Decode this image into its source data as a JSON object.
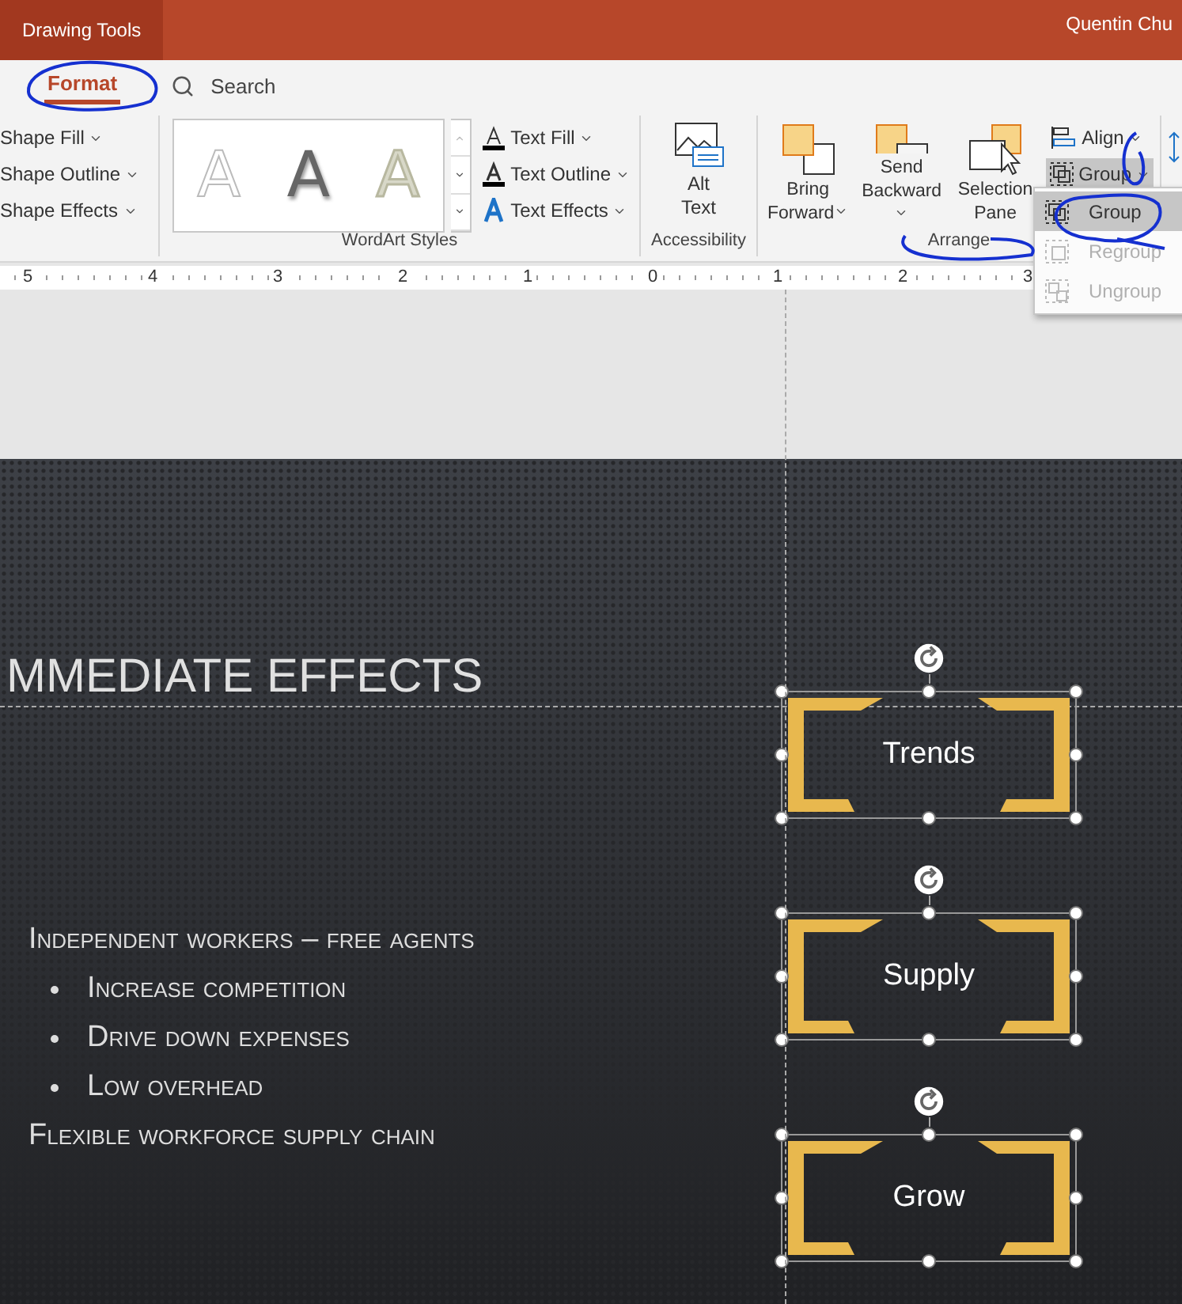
{
  "title_bar": {
    "context_tab": "Drawing Tools",
    "user": "Quentin Chu"
  },
  "tabs": [
    {
      "label": "Format",
      "selected": true
    }
  ],
  "search": {
    "placeholder": "Search"
  },
  "shape_styles": {
    "items": [
      "Shape Fill",
      "Shape Outline",
      "Shape Effects"
    ]
  },
  "wordart": {
    "label": "WordArt Styles",
    "gallery": [
      {
        "glyph": "A",
        "kind": "outline"
      },
      {
        "glyph": "A",
        "kind": "shadow"
      },
      {
        "glyph": "A",
        "kind": "gold"
      }
    ],
    "items": [
      {
        "label": "Text Fill",
        "kind": "fill"
      },
      {
        "label": "Text Outline",
        "kind": "outline"
      },
      {
        "label": "Text Effects",
        "kind": "effects"
      }
    ]
  },
  "accessibility": {
    "label": "Accessibility",
    "button": "Alt Text"
  },
  "arrange": {
    "label": "Arrange",
    "large": [
      {
        "label": "Bring Forward",
        "kind": "forward",
        "dropdown": true
      },
      {
        "label": "Send Backward",
        "kind": "backward",
        "dropdown": true
      },
      {
        "label": "Selection Pane",
        "kind": "pane",
        "dropdown": false
      }
    ],
    "small": [
      {
        "label": "Align",
        "kind": "align",
        "pressed": false
      },
      {
        "label": "Group",
        "kind": "group",
        "pressed": true
      }
    ]
  },
  "group_menu": [
    {
      "label": "Group",
      "kind": "group",
      "selected": true,
      "disabled": false
    },
    {
      "label": "Regroup",
      "kind": "regroup",
      "selected": false,
      "disabled": true
    },
    {
      "label": "Ungroup",
      "kind": "ungroup",
      "selected": false,
      "disabled": true
    }
  ],
  "ruler": [
    "5",
    "4",
    "3",
    "2",
    "1",
    "0",
    "1",
    "2",
    "3"
  ],
  "slide": {
    "title": "MMEDIATE EFFECTS",
    "bullets": [
      {
        "text": "Independent workers – free agents",
        "children": [
          {
            "text": "Increase competition"
          },
          {
            "text": "Drive down expenses"
          },
          {
            "text": "Low overhead"
          }
        ]
      },
      {
        "text": "Flexible workforce supply chain"
      }
    ],
    "shapes": [
      {
        "label": "Trends"
      },
      {
        "label": "Supply"
      },
      {
        "label": "Grow"
      }
    ]
  }
}
